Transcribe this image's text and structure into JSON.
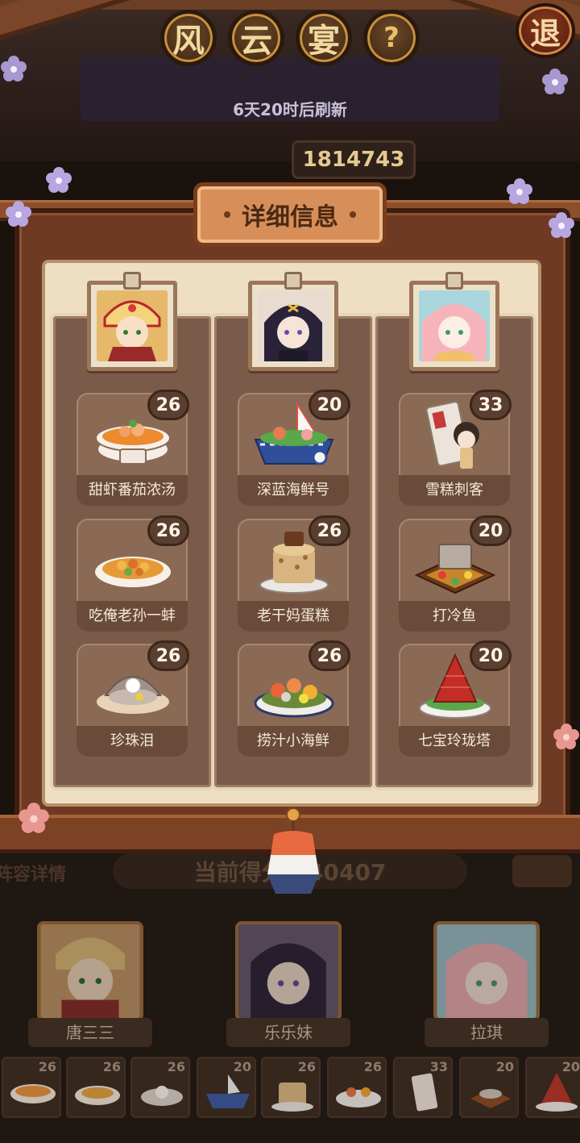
{
  "header": {
    "title_chars": [
      "风",
      "云",
      "宴"
    ],
    "help_label": "?",
    "exit_label": "退",
    "refresh_text": "6天20时后刷新",
    "score": "1814743"
  },
  "modal": {
    "title": "详细信息",
    "columns": [
      {
        "character": "唐三三",
        "portrait_icon": "warrior-portrait-icon",
        "dishes": [
          {
            "name": "甜虾番茄浓汤",
            "level": "26",
            "icon": "shrimp-tomato-soup-icon"
          },
          {
            "name": "吃俺老孙一蚌",
            "level": "26",
            "icon": "clam-stir-fry-icon"
          },
          {
            "name": "珍珠泪",
            "level": "26",
            "icon": "pearl-oyster-icon"
          }
        ]
      },
      {
        "character": "乐乐妹",
        "portrait_icon": "dark-hair-girl-portrait-icon",
        "dishes": [
          {
            "name": "深蓝海鲜号",
            "level": "20",
            "icon": "seafood-boat-icon"
          },
          {
            "name": "老干妈蛋糕",
            "level": "26",
            "icon": "chili-cake-icon"
          },
          {
            "name": "捞汁小海鲜",
            "level": "26",
            "icon": "seafood-platter-icon"
          }
        ]
      },
      {
        "character": "拉琪",
        "portrait_icon": "pink-hair-girl-portrait-icon",
        "dishes": [
          {
            "name": "雪糕刺客",
            "level": "33",
            "icon": "ice-cream-bar-icon"
          },
          {
            "name": "打冷鱼",
            "level": "20",
            "icon": "cold-fish-platter-icon"
          },
          {
            "name": "七宝玲珑塔",
            "level": "20",
            "icon": "pyramid-dessert-icon"
          }
        ]
      }
    ]
  },
  "background": {
    "lineup_label": "阵容详情",
    "current_score": "当前得分 040407",
    "team": [
      "唐三三",
      "乐乐妹",
      "拉琪"
    ],
    "strip_levels": [
      "26",
      "26",
      "26",
      "20",
      "26",
      "26",
      "33",
      "20",
      "20"
    ]
  }
}
